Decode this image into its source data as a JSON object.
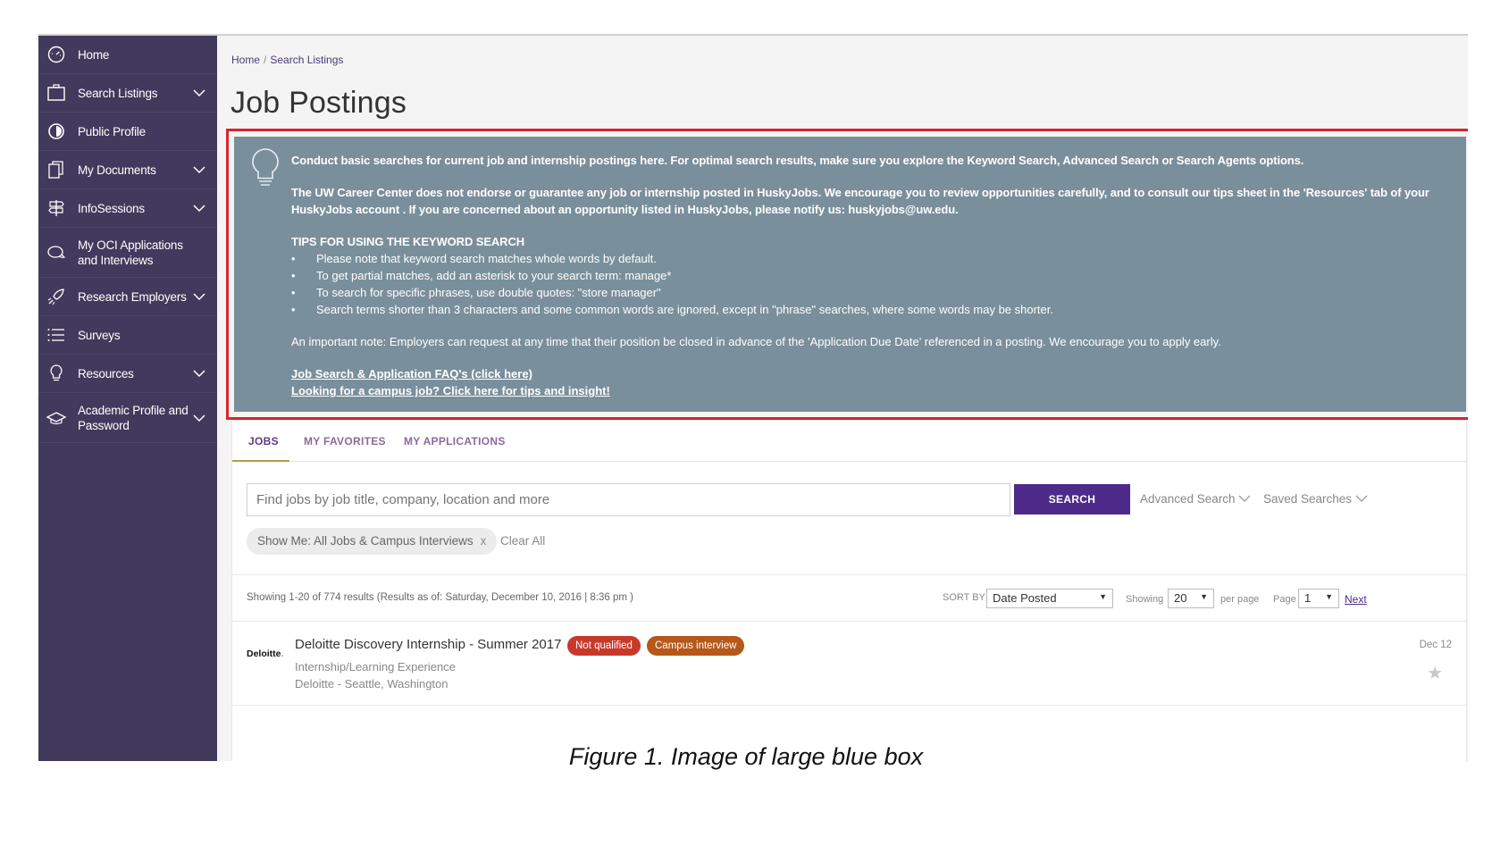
{
  "sidebar": {
    "items": [
      {
        "label": "Home",
        "icon": "dashboard-icon",
        "chevron": false
      },
      {
        "label": "Search Listings",
        "icon": "briefcase-icon",
        "chevron": true
      },
      {
        "label": "Public Profile",
        "icon": "profile-icon",
        "chevron": false
      },
      {
        "label": "My Documents",
        "icon": "documents-icon",
        "chevron": true
      },
      {
        "label": "InfoSessions",
        "icon": "signpost-icon",
        "chevron": true
      },
      {
        "label": "My OCI Applications and Interviews",
        "icon": "chat-icon",
        "chevron": false
      },
      {
        "label": "Research Employers",
        "icon": "rocket-icon",
        "chevron": true
      },
      {
        "label": "Surveys",
        "icon": "list-icon",
        "chevron": false
      },
      {
        "label": "Resources",
        "icon": "lightbulb-icon",
        "chevron": true
      },
      {
        "label": "Academic Profile and Password",
        "icon": "graduation-cap-icon",
        "chevron": true
      }
    ]
  },
  "breadcrumb": {
    "home": "Home",
    "separator": "/",
    "current": "Search Listings"
  },
  "page_title": "Job Postings",
  "info_box": {
    "intro": "Conduct basic searches for current job and internship postings here. For optimal search results, make sure you explore the Keyword Search, Advanced Search or Search Agents options.",
    "disclaimer": "The UW Career Center does not endorse or guarantee any job or internship posted in HuskyJobs. We encourage you to review opportunities carefully, and to consult our tips sheet in the 'Resources' tab of your HuskyJobs account . If you are concerned about an opportunity listed in HuskyJobs, please notify us: huskyjobs@uw.edu.",
    "tips_heading": "TIPS FOR USING THE KEYWORD SEARCH",
    "tips": [
      "Please note that keyword search matches whole words by default.",
      "To get partial matches, add an asterisk to your search term: manage*",
      "To search for specific phrases, use double quotes: \"store manager\"",
      "Search terms shorter than 3 characters and some common words are ignored, except in \"phrase\" searches, where some words may be shorter."
    ],
    "note": "An important note: Employers can request at any time that their position be closed in advance of the 'Application Due Date' referenced in a posting. We encourage you to apply early.",
    "link_faq": "Job Search & Application FAQ's (click here)",
    "link_campus": "Looking for a campus job? Click here for tips and insight!",
    "highlight_color": "#d6262f",
    "bg_color": "#7a8f9c"
  },
  "tabs": [
    {
      "label": "JOBS",
      "active": true
    },
    {
      "label": "MY FAVORITES",
      "active": false
    },
    {
      "label": "MY APPLICATIONS",
      "active": false
    }
  ],
  "search": {
    "placeholder": "Find jobs by job title, company, location and more",
    "button": "SEARCH",
    "advanced": "Advanced Search",
    "saved": "Saved Searches"
  },
  "filters": {
    "chip": "Show Me: All Jobs & Campus Interviews",
    "chip_remove": "x",
    "clear_all": "Clear All"
  },
  "results": {
    "summary": "Showing 1-20 of 774 results  (Results as of: Saturday, December 10, 2016 | 8:36 pm )",
    "sort_by_label": "SORT BY",
    "sort_by_value": "Date Posted",
    "showing_label": "Showing",
    "per_page_value": "20",
    "per_page_label": "per page",
    "page_label": "Page",
    "page_value": "1",
    "next": "Next"
  },
  "job": {
    "logo": "Deloitte",
    "logo_dot": ".",
    "title": "Deloitte Discovery Internship - Summer 2017",
    "badge_not_qualified": "Not qualified",
    "badge_campus": "Campus interview",
    "type": "Internship/Learning Experience",
    "location": "Deloitte - Seattle, Washington",
    "date": "Dec 12"
  },
  "caption": "Figure 1. Image of large blue box",
  "colors": {
    "sidebar": "#413a5c",
    "primary": "#4e2a8a",
    "badge_red": "#c8392b",
    "badge_orange": "#b5581a"
  }
}
